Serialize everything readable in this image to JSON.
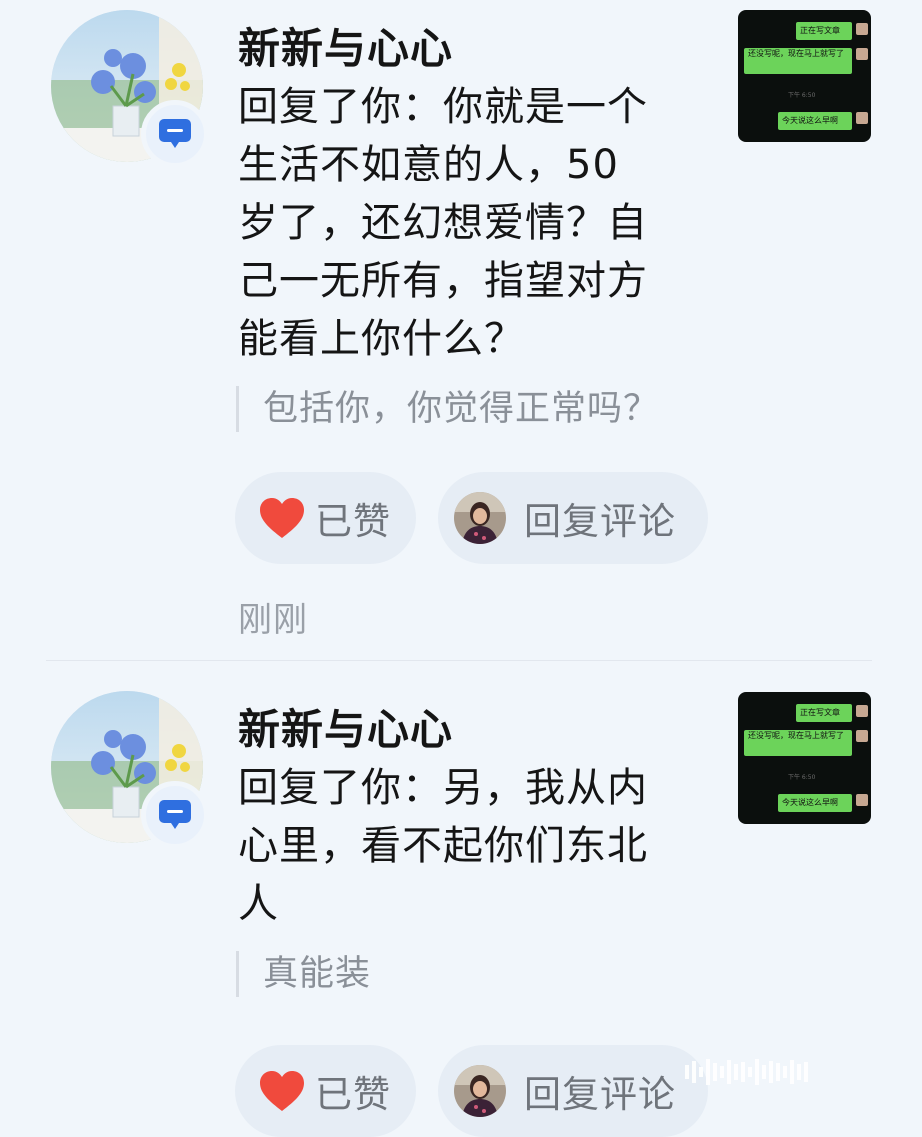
{
  "notifications": [
    {
      "username": "新新与心心",
      "reply_lines": [
        "回复了你：你就是一个",
        "生活不如意的人，50",
        "岁了，还幻想爱情？自",
        "己一无所有，指望对方",
        "能看上你什么？"
      ],
      "quoted": "包括你，你觉得正常吗？",
      "like_label": "已赞",
      "reply_label": "回复评论",
      "time": "刚刚",
      "thumbnail": {
        "bubbles": [
          "正在写文章",
          "还没写呢，现在马上就写了",
          "今天说这么早啊"
        ],
        "meta": "下午 6:50"
      }
    },
    {
      "username": "新新与心心",
      "reply_lines": [
        "回复了你：另，我从内",
        "心里，看不起你们东北",
        "人"
      ],
      "quoted": "真能装",
      "like_label": "已赞",
      "reply_label": "回复评论",
      "thumbnail": {
        "bubbles": [
          "正在写文章",
          "还没写呢，现在马上就写了",
          "今天说这么早啊"
        ],
        "meta": "下午 6:50"
      }
    }
  ],
  "colors": {
    "background": "#f1f6fb",
    "pill": "#e6edf5",
    "heart": "#f04a3d",
    "badge_icon": "#2f6fe0",
    "muted_text": "#8a9098"
  },
  "icons": {
    "avatar": "flower-avatar-icon",
    "badge": "reply-bubble-icon",
    "like": "heart-icon"
  }
}
